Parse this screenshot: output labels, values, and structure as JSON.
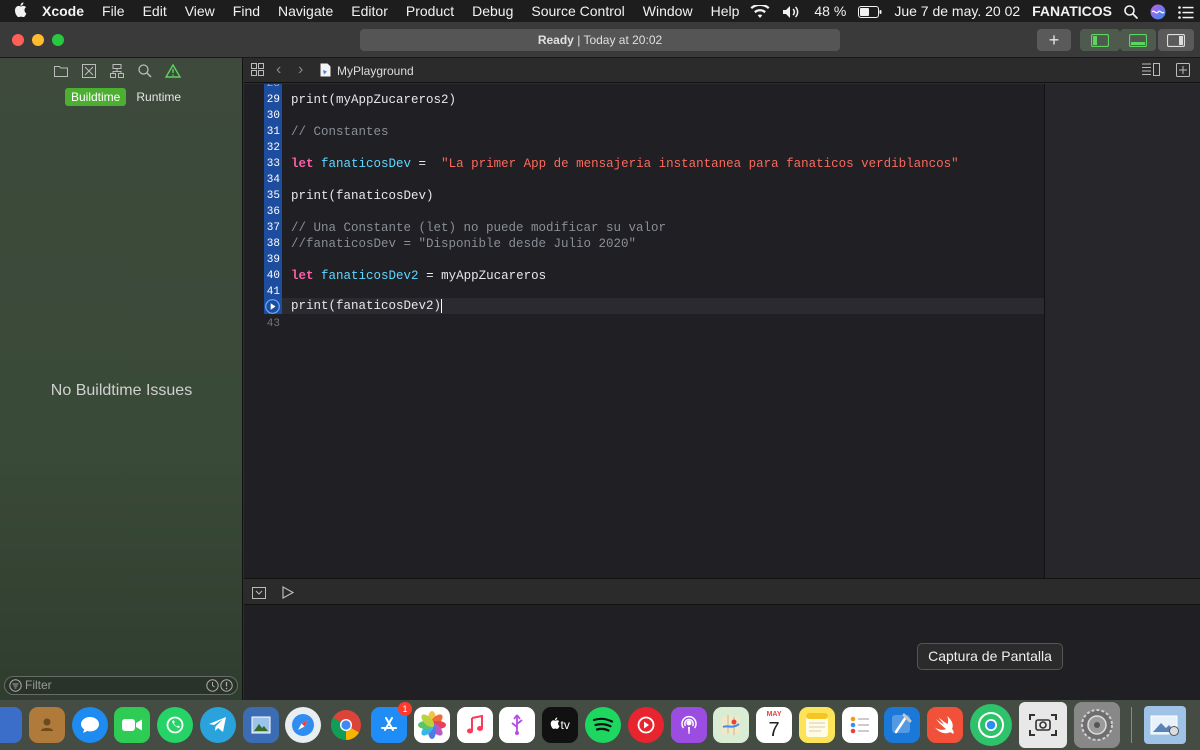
{
  "menubar": {
    "app": "Xcode",
    "items": [
      "File",
      "Edit",
      "View",
      "Find",
      "Navigate",
      "Editor",
      "Product",
      "Debug",
      "Source Control",
      "Window",
      "Help"
    ],
    "battery": "48 %",
    "datetime": "Jue 7 de may.  20 02",
    "user": "FANATICOS"
  },
  "toolbar": {
    "status": "Ready",
    "status_detail": "Today at 20:02",
    "add_label": "+"
  },
  "navigator": {
    "seg_buildtime": "Buildtime",
    "seg_runtime": "Runtime",
    "empty_message": "No Buildtime Issues",
    "filter_placeholder": "Filter"
  },
  "jumpbar": {
    "file": "MyPlayground"
  },
  "editor": {
    "lines": [
      {
        "n": "29"
      },
      {
        "n": "30"
      },
      {
        "n": "31"
      },
      {
        "n": "32"
      },
      {
        "n": "33"
      },
      {
        "n": "34"
      },
      {
        "n": "35"
      },
      {
        "n": "36"
      },
      {
        "n": "37"
      },
      {
        "n": "38"
      },
      {
        "n": "39"
      },
      {
        "n": "40"
      },
      {
        "n": "41"
      },
      {
        "n": "43"
      }
    ],
    "code": {
      "l29": "print(myAppZucareros2)",
      "l31": "// Constantes",
      "l33_kw": "let",
      "l33_id": "fanaticosDev",
      "l33_op": " =  ",
      "l33_str": "\"La primer App de mensajeria instantanea para fanaticos verdiblancos\"",
      "l35": "print(fanaticosDev)",
      "l37": "// Una Constante (let) no puede modificar su valor",
      "l38": "//fanaticosDev = \"Disponible desde Julio 2020\"",
      "l40_kw": "let",
      "l40_id": "fanaticosDev2",
      "l40_rest": " = myAppZucareros",
      "l42": "print(fanaticosDev2)"
    }
  },
  "tooltip": "Captura de Pantalla",
  "dock": {
    "calendar_month": "MAY",
    "calendar_day": "7",
    "appstore_badge": "1",
    "tv_label": "tv"
  }
}
